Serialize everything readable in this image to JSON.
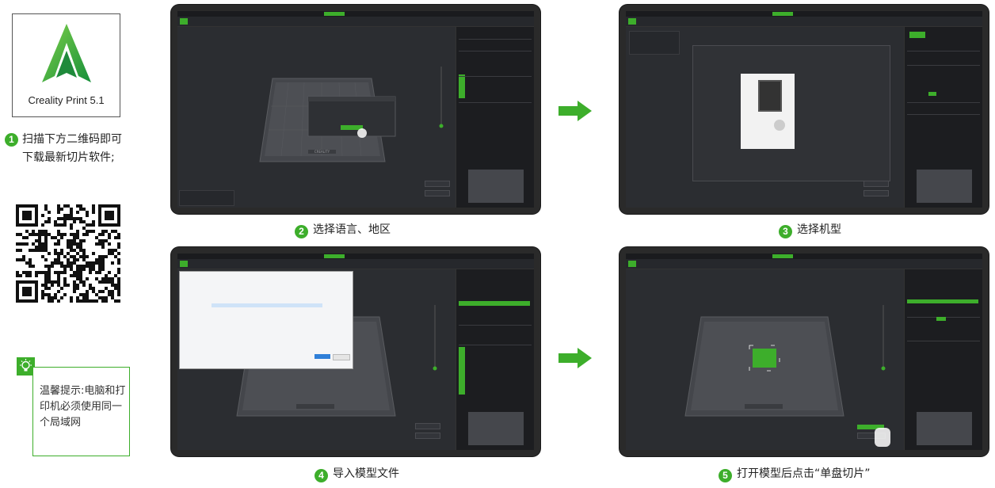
{
  "logo": {
    "caption": "Creality Print 5.1"
  },
  "step1": {
    "number": "1",
    "text": "扫描下方二维码即可下载最新切片软件;"
  },
  "tip": {
    "icon": "lightbulb-icon",
    "text": "温馨提示:电脑和打印机必须使用同一个局域网"
  },
  "steps": [
    {
      "number": "2",
      "label": "选择语言、地区"
    },
    {
      "number": "3",
      "label": "选择机型"
    },
    {
      "number": "4",
      "label": "导入模型文件"
    },
    {
      "number": "5",
      "label": "打开模型后点击“单盘切片”"
    }
  ],
  "bed_brand": "CREALITY",
  "colors": {
    "accent": "#3dae2b",
    "screen_bg": "#202226"
  }
}
